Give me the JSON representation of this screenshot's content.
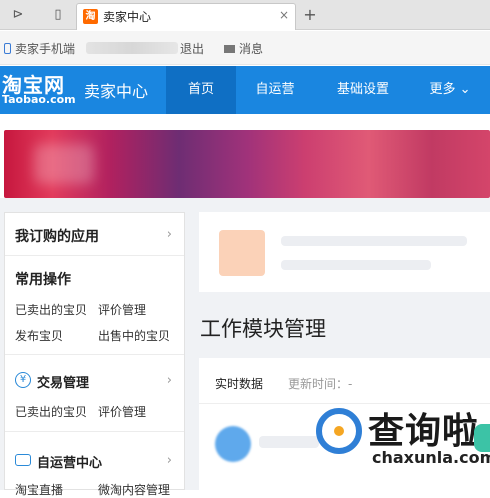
{
  "browser": {
    "tab_title": "卖家中心",
    "tab_favicon": "淘",
    "new_tab": "+",
    "close": "×"
  },
  "topbar": {
    "phone_label": "卖家手机端",
    "logout": "退出",
    "messages": "消息"
  },
  "header": {
    "logo_main": "淘宝网",
    "logo_sub": "Taobao.com",
    "seller_title": "卖家中心",
    "nav": [
      {
        "label": "首页",
        "active": true
      },
      {
        "label": "自运营"
      },
      {
        "label": "基础设置"
      },
      {
        "label": "更多 ⌄"
      }
    ],
    "colors": {
      "primary": "#1a86e0",
      "active": "#0f6fc4"
    }
  },
  "sidebar": {
    "subscribed_apps": "我订购的应用",
    "common_ops": "常用操作",
    "common_links": [
      "已卖出的宝贝",
      "评价管理",
      "发布宝贝",
      "出售中的宝贝"
    ],
    "trade_mgmt": "交易管理",
    "trade_links": [
      "已卖出的宝贝",
      "评价管理"
    ],
    "self_ops_center": "自运营中心",
    "self_ops_links": [
      "淘宝直播",
      "微淘内容管理"
    ],
    "chevron": "›"
  },
  "main": {
    "section_title": "工作模块管理",
    "realtime_tab": "实时数据",
    "update_time": "更新时间：-"
  },
  "watermark": {
    "text": "查询啦",
    "url": "chaxunla.com"
  }
}
